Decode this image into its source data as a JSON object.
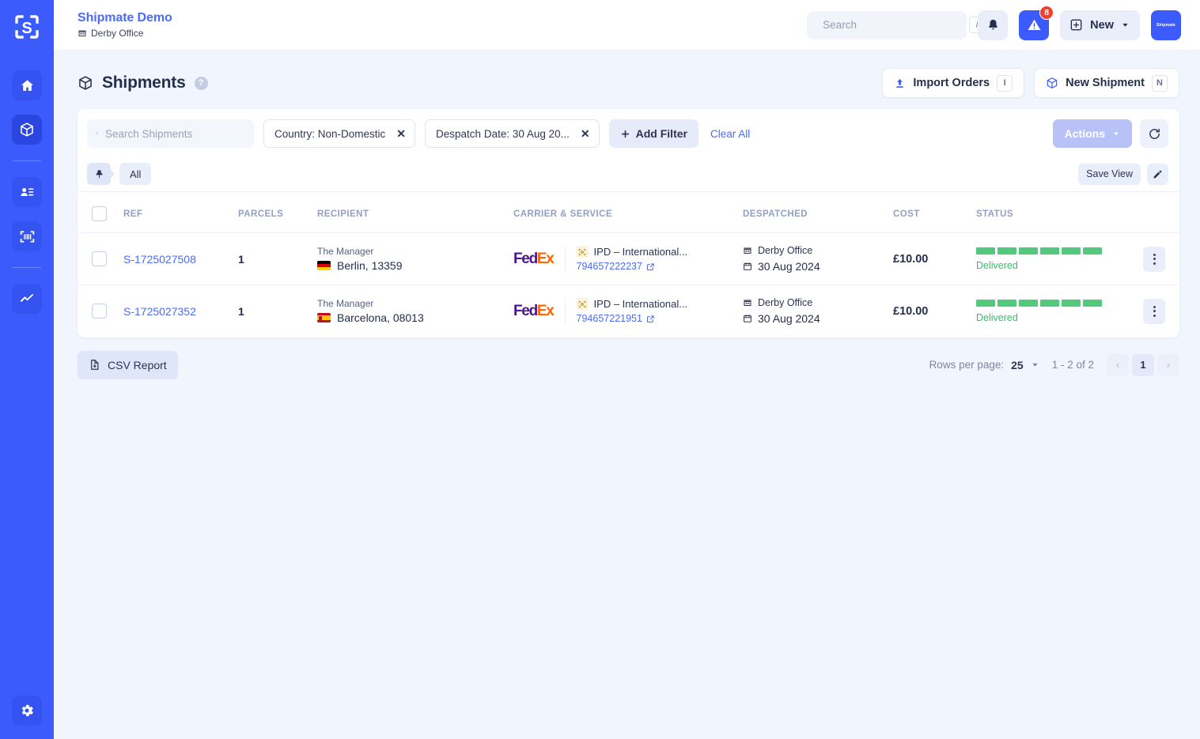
{
  "sidebar": {
    "logo_icon": "shipmate-scan-logo-icon",
    "items": [
      {
        "name": "home",
        "icon": "home-icon",
        "active": false
      },
      {
        "name": "shipments",
        "icon": "package-icon",
        "active": true
      },
      {
        "name": "contacts",
        "icon": "contact-card-icon",
        "active": false
      },
      {
        "name": "barcode",
        "icon": "barcode-scan-icon",
        "active": false
      },
      {
        "name": "analytics",
        "icon": "trend-line-icon",
        "active": false
      }
    ],
    "settings": {
      "name": "settings",
      "icon": "gear-icon"
    }
  },
  "topbar": {
    "brand_title": "Shipmate Demo",
    "brand_sub": "Derby Office",
    "brand_sub_icon": "office-building-icon",
    "search": {
      "placeholder": "Search",
      "value": "",
      "icon": "search-icon",
      "shortcut": "/"
    },
    "notifications": {
      "icon": "bell-icon"
    },
    "alerts": {
      "icon": "warning-triangle-icon",
      "badge": "8"
    },
    "new_button": {
      "label": "New",
      "icon": "plus-square-icon",
      "caret": "chevron-down-icon"
    },
    "avatar": {
      "label": "Shipmate"
    }
  },
  "page": {
    "title": "Shipments",
    "title_icon": "package-icon",
    "help_icon": "?",
    "import_orders": {
      "label": "Import Orders",
      "icon": "upload-icon",
      "shortcut": "I"
    },
    "new_shipment": {
      "label": "New Shipment",
      "icon": "package-icon",
      "shortcut": "N"
    }
  },
  "filters": {
    "search": {
      "placeholder": "Search Shipments",
      "value": "",
      "icon": "search-icon"
    },
    "chips": [
      {
        "label": "Country: Non-Domestic",
        "remove_icon": "close-icon"
      },
      {
        "label": "Despatch Date: 30 Aug 20...",
        "remove_icon": "close-icon"
      }
    ],
    "add_filter": {
      "label": "Add Filter",
      "icon": "plus-icon"
    },
    "clear_all": "Clear All",
    "actions": {
      "label": "Actions",
      "caret": "chevron-down-icon",
      "disabled": true
    },
    "refresh": {
      "icon": "refresh-icon"
    }
  },
  "viewbar": {
    "pin": {
      "icon": "pin-icon"
    },
    "tab": "All",
    "save_view": "Save View",
    "edit_view": {
      "icon": "pencil-icon"
    }
  },
  "table": {
    "columns": [
      "REF",
      "PARCELS",
      "RECIPIENT",
      "CARRIER & SERVICE",
      "DESPATCHED",
      "COST",
      "STATUS"
    ],
    "rows": [
      {
        "ref": "S-1725027508",
        "parcels": "1",
        "recipient_name": "The Manager",
        "recipient_city": "Berlin, 13359",
        "flag": "de",
        "carrier": "FedEx",
        "service": "IPD – International...",
        "service_icon": "package-scan-icon",
        "tracking": "794657222237",
        "tracking_icon": "external-link-icon",
        "despatched_office": "Derby Office",
        "despatched_office_icon": "office-building-icon",
        "despatched_date": "30 Aug 2024",
        "despatched_date_icon": "calendar-icon",
        "cost": "£10.00",
        "status": "Delivered",
        "status_segments": 6,
        "status_filled": 6,
        "menu_icon": "kebab-menu-icon"
      },
      {
        "ref": "S-1725027352",
        "parcels": "1",
        "recipient_name": "The Manager",
        "recipient_city": "Barcelona, 08013",
        "flag": "es",
        "carrier": "FedEx",
        "service": "IPD – International...",
        "service_icon": "package-scan-icon",
        "tracking": "794657221951",
        "tracking_icon": "external-link-icon",
        "despatched_office": "Derby Office",
        "despatched_office_icon": "office-building-icon",
        "despatched_date": "30 Aug 2024",
        "despatched_date_icon": "calendar-icon",
        "cost": "£10.00",
        "status": "Delivered",
        "status_segments": 6,
        "status_filled": 6,
        "menu_icon": "kebab-menu-icon"
      }
    ]
  },
  "footer": {
    "csv_report": {
      "label": "CSV Report",
      "icon": "file-download-icon"
    },
    "rows_per_page_label": "Rows per page:",
    "rows_per_page_value": "25",
    "rows_per_page_caret": "chevron-down-icon",
    "range": "1 - 2 of 2",
    "prev": "‹",
    "page": "1",
    "next": "›"
  },
  "colors": {
    "brand_blue": "#3b5bfd",
    "link_blue": "#4a6cf7",
    "status_green": "#52c97d",
    "badge_red": "#f0402e",
    "fedex_purple": "#4d148c",
    "fedex_orange": "#ff6600"
  }
}
